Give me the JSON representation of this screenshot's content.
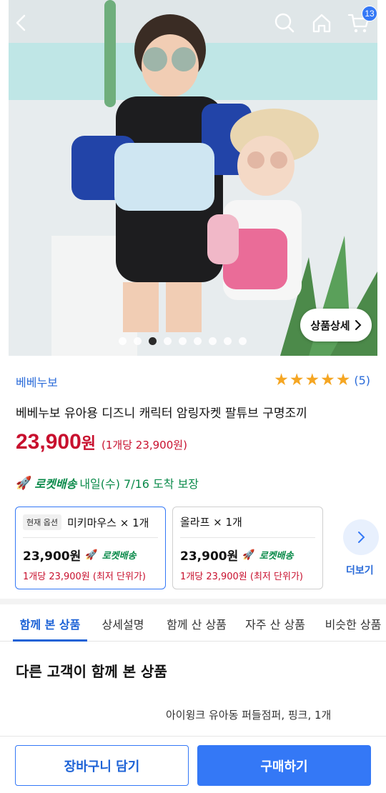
{
  "header": {
    "cart_count": "13"
  },
  "hero": {
    "detail_button_label": "상품상세",
    "image_count": 9,
    "active_index": 2
  },
  "product": {
    "brand": "베베누보",
    "rating_stars": 5,
    "review_count": "(5)",
    "title": "베베누보 유아용 디즈니 캐릭터 암링자켓 팔튜브 구명조끼",
    "price": "23,900",
    "price_currency": "원",
    "unit_price": "(1개당 23,900원)",
    "delivery_badge": "로켓배송",
    "delivery_text": "내일(수) 7/16 도착 보장"
  },
  "options": [
    {
      "tag": "현재 옵션",
      "name": "미키마우스 × 1개",
      "price": "23,900원",
      "badge": "로켓배송",
      "unit": "1개당 23,900원 (최저 단위가)",
      "selected": true
    },
    {
      "tag": "",
      "name": "올라프 × 1개",
      "price": "23,900원",
      "badge": "로켓배송",
      "unit": "1개당 23,900원 (최저 단위가)",
      "selected": false
    }
  ],
  "more_label": "더보기",
  "tabs": [
    "함께 본 상품",
    "상세설명",
    "함께 산 상품",
    "자주 산 상품",
    "비슷한 상품"
  ],
  "active_tab": 0,
  "section": {
    "title": "다른 고객이 함께 본 상품",
    "item": "아이윙크 유아동 퍼들점퍼, 핑크, 1개"
  },
  "bottom": {
    "cart_label": "장바구니 담기",
    "buy_label": "구매하기"
  },
  "colors": {
    "accent": "#3478f6",
    "price_red": "#c8102e",
    "rocket_green": "#0a8a4a",
    "star": "#f5a623"
  }
}
